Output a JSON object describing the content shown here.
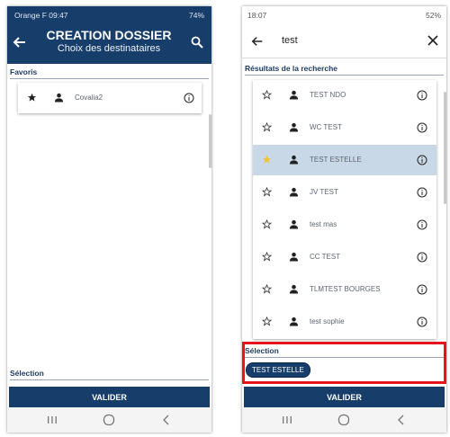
{
  "left": {
    "status": {
      "carrier_time": "Orange F 09:47",
      "right": "74%"
    },
    "header": {
      "title": "CREATION DOSSIER",
      "subtitle": "Choix des destinataires"
    },
    "favorites_heading": "Favoris",
    "favorites": [
      {
        "label": "Covalia2",
        "starred": true
      }
    ],
    "selection_heading": "Sélection",
    "validate_label": "VALIDER",
    "navbar": {
      "recent": "|||",
      "home": "○",
      "back": "‹"
    }
  },
  "right": {
    "status": {
      "time": "18:07",
      "right": "52%"
    },
    "search": {
      "query": "test"
    },
    "results_heading": "Résultats de la recherche",
    "results": [
      {
        "label": "TEST NDO",
        "starred": false,
        "selected": false
      },
      {
        "label": "WC TEST",
        "starred": false,
        "selected": false
      },
      {
        "label": "TEST ESTELLE",
        "starred": true,
        "selected": true
      },
      {
        "label": "JV TEST",
        "starred": false,
        "selected": false
      },
      {
        "label": "test mas",
        "starred": false,
        "selected": false
      },
      {
        "label": "CC TEST",
        "starred": false,
        "selected": false
      },
      {
        "label": "TLMTEST BOURGES",
        "starred": false,
        "selected": false
      },
      {
        "label": "test sophie",
        "starred": false,
        "selected": false
      }
    ],
    "selection_heading": "Sélection",
    "selected_chip": "TEST ESTELLE",
    "validate_label": "VALIDER",
    "navbar": {
      "recent": "|||",
      "home": "○",
      "back": "‹"
    }
  },
  "colors": {
    "primary": "#173d6b",
    "selected_row": "#c9d8e6",
    "star_gold": "#f2c230",
    "highlight_red": "#e5131a"
  }
}
